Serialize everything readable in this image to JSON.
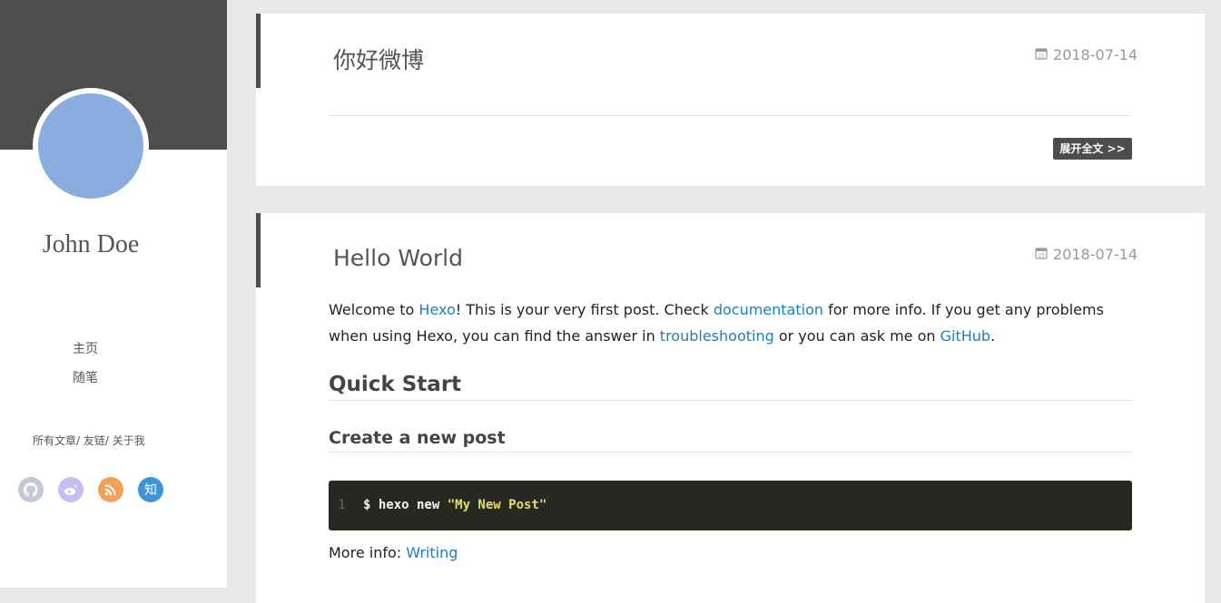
{
  "sidebar": {
    "author": "John Doe",
    "nav": [
      {
        "label": "主页"
      },
      {
        "label": "随笔"
      }
    ],
    "links": [
      "所有文章",
      "友链",
      "关于我"
    ],
    "link_separator": "/ ",
    "socials": [
      {
        "name": "github",
        "icon": "github-icon",
        "color": "#c3c9d6"
      },
      {
        "name": "weibo",
        "icon": "weibo-icon",
        "color": "#c8bcf5"
      },
      {
        "name": "rss",
        "icon": "rss-icon",
        "color": "#f2a15d"
      },
      {
        "name": "zhihu",
        "icon": "zhihu-icon",
        "color": "#3d95d8",
        "glyph": "知"
      }
    ],
    "colors": {
      "header": "#4d4d4d",
      "avatar": "#8aaddf"
    }
  },
  "posts": [
    {
      "title": "你好微博",
      "date": "2018-07-14",
      "read_more": "展开全文 >>"
    },
    {
      "title": "Hello World",
      "date": "2018-07-14",
      "intro": {
        "t1": "Welcome to ",
        "l1": "Hexo",
        "t2": "! This is your very first post. Check ",
        "l2": "documentation",
        "t3": " for more info. If you get any problems when using Hexo, you can find the answer in ",
        "l3": "troubleshooting",
        "t4": " or you can ask me on ",
        "l4": "GitHub",
        "t5": "."
      },
      "h2": "Quick Start",
      "h3": "Create a new post",
      "code": {
        "line_number": "1",
        "cmd": "$ hexo new ",
        "arg": "\"My New Post\""
      },
      "more_info": {
        "label": "More info: ",
        "link": "Writing"
      }
    }
  ],
  "colors": {
    "link": "#1f7ebf",
    "code_bg": "#272822",
    "code_string": "#e6db74",
    "page_bg": "#e8e8e8"
  }
}
